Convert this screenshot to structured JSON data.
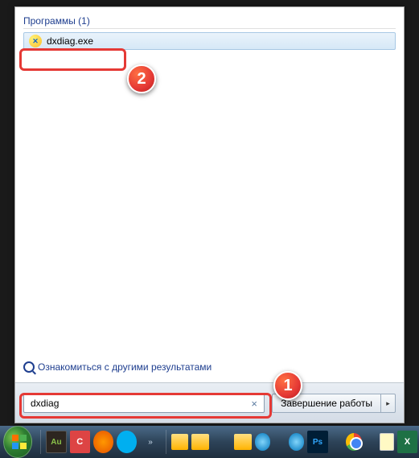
{
  "section": {
    "title": "Программы (1)"
  },
  "result": {
    "name": "dxdiag.exe"
  },
  "more": {
    "label": "Ознакомиться с другими результатами"
  },
  "search": {
    "value": "dxdiag",
    "clear": "×"
  },
  "shutdown": {
    "label": "Завершение работы",
    "arrow": "▸"
  },
  "callouts": {
    "c1": "1",
    "c2": "2"
  },
  "taskbar": {
    "au": "Au",
    "cr": "C",
    "chev": "»",
    "ps": "Ps",
    "xl": "X"
  }
}
